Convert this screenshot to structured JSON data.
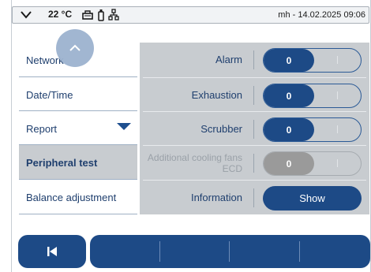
{
  "status_bar": {
    "icons": [
      "chevron-down-icon",
      "thermometer-icon",
      "printer-icon",
      "bottle-icon",
      "network-icon"
    ],
    "temperature": "22 °C",
    "user_datetime": "mh - 14.02.2025 09:06"
  },
  "menu": {
    "items": [
      {
        "label": "Network"
      },
      {
        "label": "Date/Time"
      },
      {
        "label": "Report"
      },
      {
        "label": "Peripheral test"
      },
      {
        "label": "Balance adjustment"
      }
    ],
    "selected": "Peripheral test"
  },
  "peripherals": [
    {
      "label": "Alarm",
      "value": "0",
      "enabled": true
    },
    {
      "label": "Exhaustion",
      "value": "0",
      "enabled": true
    },
    {
      "label": "Scrubber",
      "value": "0",
      "enabled": true
    },
    {
      "label": "Additional cooling fans ECD",
      "value": "0",
      "enabled": false
    }
  ],
  "information": {
    "label": "Information",
    "button": "Show"
  },
  "colors": {
    "accent": "#1d4a86",
    "panel": "#c8ccd0",
    "text": "#1f3f6e"
  }
}
